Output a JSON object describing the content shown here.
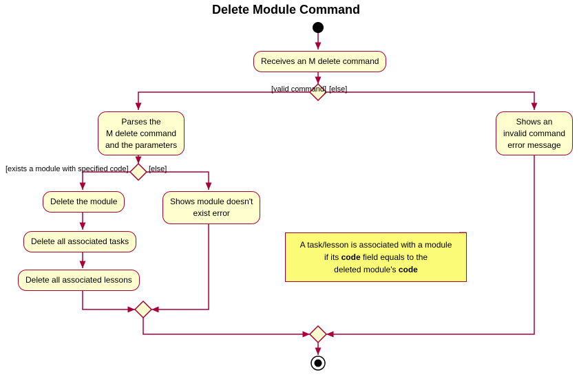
{
  "chart_data": {
    "type": "activity-diagram",
    "title": "Delete Module Command",
    "nodes": [
      {
        "id": "start",
        "type": "initial"
      },
      {
        "id": "receives",
        "type": "activity",
        "label": "Receives an M delete command"
      },
      {
        "id": "d1",
        "type": "decision",
        "branches": [
          {
            "guard": "[valid command]",
            "to": "parses"
          },
          {
            "guard": "[else]",
            "to": "invalid"
          }
        ]
      },
      {
        "id": "parses",
        "type": "activity",
        "label": "Parses the\nM delete command\nand the parameters"
      },
      {
        "id": "invalid",
        "type": "activity",
        "label": "Shows an\ninvalid command\nerror message"
      },
      {
        "id": "d2",
        "type": "decision",
        "branches": [
          {
            "guard": "[exists a module with specified code]",
            "to": "delmod"
          },
          {
            "guard": "[else]",
            "to": "noexist"
          }
        ]
      },
      {
        "id": "delmod",
        "type": "activity",
        "label": "Delete the module"
      },
      {
        "id": "deltasks",
        "type": "activity",
        "label": "Delete all associated tasks"
      },
      {
        "id": "dellessons",
        "type": "activity",
        "label": "Delete all associated lessons"
      },
      {
        "id": "noexist",
        "type": "activity",
        "label": "Shows module doesn't\nexist error"
      },
      {
        "id": "m2",
        "type": "merge"
      },
      {
        "id": "m1",
        "type": "merge"
      },
      {
        "id": "end",
        "type": "final"
      }
    ],
    "edges": [
      [
        "start",
        "receives"
      ],
      [
        "receives",
        "d1"
      ],
      [
        "d1",
        "parses"
      ],
      [
        "d1",
        "invalid"
      ],
      [
        "parses",
        "d2"
      ],
      [
        "d2",
        "delmod"
      ],
      [
        "d2",
        "noexist"
      ],
      [
        "delmod",
        "deltasks"
      ],
      [
        "deltasks",
        "dellessons"
      ],
      [
        "dellessons",
        "m2"
      ],
      [
        "noexist",
        "m2"
      ],
      [
        "m2",
        "m1"
      ],
      [
        "invalid",
        "m1"
      ],
      [
        "m1",
        "end"
      ]
    ],
    "note": "A task/lesson is associated with a module\nif its code field equals to the\ndeleted module's code",
    "note_bold_words": [
      "code",
      "code"
    ]
  },
  "title": "Delete Module Command",
  "boxes": {
    "receives": "Receives an M delete command",
    "parses_l1": "Parses the",
    "parses_l2": "M delete command",
    "parses_l3": "and the parameters",
    "invalid_l1": "Shows an",
    "invalid_l2": "invalid command",
    "invalid_l3": "error message",
    "delmod": "Delete the module",
    "deltasks": "Delete all associated tasks",
    "dellessons": "Delete all associated lessons",
    "noexist_l1": "Shows module doesn't",
    "noexist_l2": "exist error"
  },
  "labels": {
    "valid": "[valid command]",
    "else1": "[else]",
    "exists": "[exists a module with specified code]",
    "else2": "[else]"
  },
  "note": {
    "l1a": "A task/lesson is associated with a module",
    "l2a": "if its ",
    "l2b": "code",
    "l2c": " field equals to the",
    "l3a": "deleted module's ",
    "l3b": "code"
  }
}
